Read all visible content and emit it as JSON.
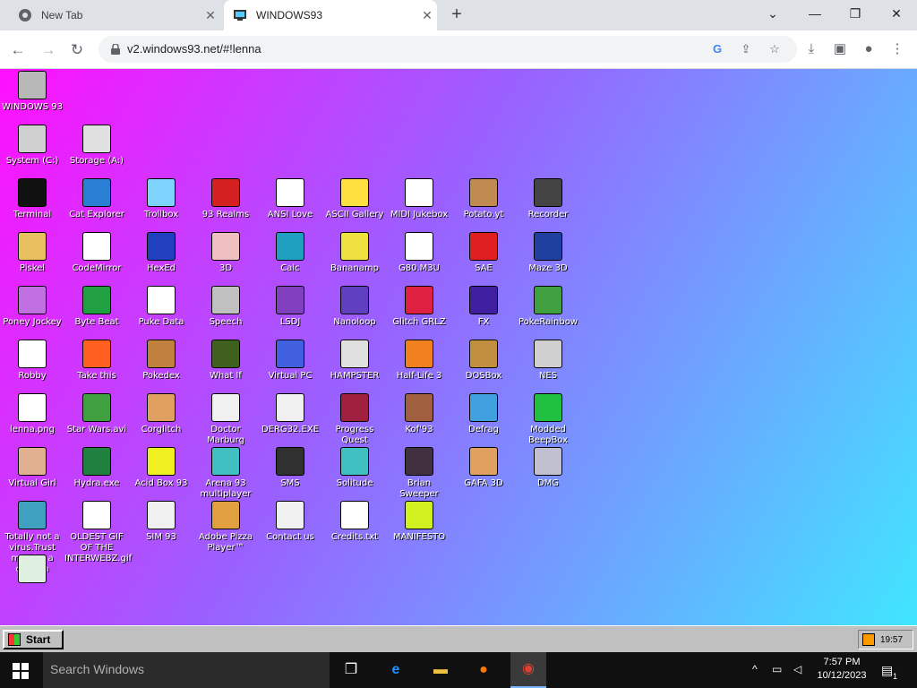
{
  "browser": {
    "tabs": [
      {
        "title": "New Tab"
      },
      {
        "title": "WINDOWS93"
      }
    ],
    "new_tab_symbol": "+",
    "url": "v2.windows93.net/#!lenna"
  },
  "desktop": {
    "icons": [
      {
        "label": "WINDOWS 93",
        "icon": "computer-icon",
        "color": "#b8b8b8"
      },
      {
        "label": "System (C:)",
        "icon": "drive-icon",
        "color": "#d0d0d0"
      },
      {
        "label": "Storage (A:)",
        "icon": "floppy-icon",
        "color": "#e0e0e0"
      },
      {
        "label": "Terminal",
        "icon": "terminal-icon",
        "color": "#111111"
      },
      {
        "label": "Cat Explorer",
        "icon": "globe-cat-icon",
        "color": "#2a7fd4"
      },
      {
        "label": "Trollbox",
        "icon": "chat-bubble-icon",
        "color": "#7fd4ff"
      },
      {
        "label": "93 Realms",
        "icon": "knight-icon",
        "color": "#d42020"
      },
      {
        "label": "ANSI Love",
        "icon": "letter-a-icon",
        "color": "#ffffff"
      },
      {
        "label": "ASCII Gallery",
        "icon": "numbers-icon",
        "color": "#ffe040"
      },
      {
        "label": "MIDI Jukebox",
        "icon": "piano-icon",
        "color": "#ffffff"
      },
      {
        "label": "Potato.yt",
        "icon": "potato-icon",
        "color": "#c08a50"
      },
      {
        "label": "Recorder",
        "icon": "microphone-icon",
        "color": "#444444"
      },
      {
        "label": "Piskel",
        "icon": "palette-icon",
        "color": "#e8c060"
      },
      {
        "label": "CodeMirror",
        "icon": "hand-icon",
        "color": "#ffffff"
      },
      {
        "label": "HexEd",
        "icon": "cube-icon",
        "color": "#2040c0"
      },
      {
        "label": "3D",
        "icon": "teapot-icon",
        "color": "#f0c0c0"
      },
      {
        "label": "Calc",
        "icon": "calculator-icon",
        "color": "#20a0c0"
      },
      {
        "label": "Bananamp",
        "icon": "banana-icon",
        "color": "#f0e040"
      },
      {
        "label": "G80.M3U",
        "icon": "music-file-icon",
        "color": "#ffffff"
      },
      {
        "label": "SAE",
        "icon": "amiga-ball-icon",
        "color": "#e02020"
      },
      {
        "label": "Maze 3D",
        "icon": "maze-icon",
        "color": "#2040a0"
      },
      {
        "label": "Poney Jockey",
        "icon": "pony-icon",
        "color": "#c070e0"
      },
      {
        "label": "Byte Beat",
        "icon": "byte-beat-icon",
        "color": "#20a040"
      },
      {
        "label": "Puke Data",
        "icon": "pd-icon",
        "color": "#ffffff"
      },
      {
        "label": "Speech",
        "icon": "face-icon",
        "color": "#c0c0c0"
      },
      {
        "label": "LSDJ",
        "icon": "gameboy-icon",
        "color": "#8040c0"
      },
      {
        "label": "Nanoloop",
        "icon": "wave-icon",
        "color": "#6040c0"
      },
      {
        "label": "Glitch GRLZ",
        "icon": "lips-icon",
        "color": "#e02040"
      },
      {
        "label": "FX",
        "icon": "atom-icon",
        "color": "#4020a0"
      },
      {
        "label": "PokeRainbow",
        "icon": "pokemon-icon",
        "color": "#40a040"
      },
      {
        "label": "Robby",
        "icon": "stick-figure-icon",
        "color": "#ffffff"
      },
      {
        "label": "Take this",
        "icon": "clown-icon",
        "color": "#ff6020"
      },
      {
        "label": "Pokedex",
        "icon": "pokedex-icon",
        "color": "#c08040"
      },
      {
        "label": "What If",
        "icon": "grid-icon",
        "color": "#406020"
      },
      {
        "label": "Virtual PC",
        "icon": "window-icon",
        "color": "#4060e0"
      },
      {
        "label": "HAMPSTER",
        "icon": "hamster-icon",
        "color": "#e0e0e0"
      },
      {
        "label": "Half-Life 3",
        "icon": "lambda-icon",
        "color": "#f08020"
      },
      {
        "label": "DOSBox",
        "icon": "dosbox-icon",
        "color": "#c09040"
      },
      {
        "label": "NES",
        "icon": "nes-icon",
        "color": "#d0d0d0"
      },
      {
        "label": "lenna.png",
        "icon": "image-file-icon",
        "color": "#ffffff"
      },
      {
        "label": "Star Wars.avi",
        "icon": "yoda-icon",
        "color": "#40a040"
      },
      {
        "label": "Corglitch",
        "icon": "corgi-icon",
        "color": "#e0a060"
      },
      {
        "label": "Doctor Marburg",
        "icon": "doctor-icon",
        "color": "#f0f0f0"
      },
      {
        "label": "DERG32.EXE",
        "icon": "monitor-face-icon",
        "color": "#f0f0f0"
      },
      {
        "label": "Progress Quest",
        "icon": "swords-icon",
        "color": "#a02040"
      },
      {
        "label": "Kof'93",
        "icon": "fighter-icon",
        "color": "#a06040"
      },
      {
        "label": "Defrag",
        "icon": "defrag-icon",
        "color": "#40a0e0"
      },
      {
        "label": "Modded BeepBox",
        "icon": "ring-icon",
        "color": "#20c040"
      },
      {
        "label": "Virtual Girl",
        "icon": "girl-portrait-icon",
        "color": "#e0b090"
      },
      {
        "label": "Hydra.exe",
        "icon": "dragon-icon",
        "color": "#208040"
      },
      {
        "label": "Acid Box 93",
        "icon": "smiley-icon",
        "color": "#f0f020"
      },
      {
        "label": "Arena 93 multiplayer",
        "icon": "3d-cube-icon",
        "color": "#40c0c0"
      },
      {
        "label": "SMS",
        "icon": "console-icon",
        "color": "#303030"
      },
      {
        "label": "Solitude",
        "icon": "jar-icon",
        "color": "#40c0c0"
      },
      {
        "label": "Brian Sweeper",
        "icon": "mine-icon",
        "color": "#403040"
      },
      {
        "label": "GAFA 3D",
        "icon": "doom-face-icon",
        "color": "#e0a060"
      },
      {
        "label": "DMG",
        "icon": "dmg-icon",
        "color": "#c0c0d0"
      },
      {
        "label": "Totally not a virus.Trust me...im a dolphin",
        "icon": "dolphin-icon",
        "color": "#40a0c0"
      },
      {
        "label": "OLDEST GIF OF THE INTERWEBZ.gif",
        "icon": "gif-file-icon",
        "color": "#ffffff"
      },
      {
        "label": "SIM 93",
        "icon": "book-icon",
        "color": "#f0f0f0"
      },
      {
        "label": "Adobe Pizza Player™",
        "icon": "pizza-icon",
        "color": "#e0a040"
      },
      {
        "label": "Contact us",
        "icon": "contact-icon",
        "color": "#f0f0f0"
      },
      {
        "label": "Credits.txt",
        "icon": "text-file-icon",
        "color": "#ffffff"
      },
      {
        "label": "MANIFESTO",
        "icon": "question-mark-icon",
        "color": "#d0f020"
      },
      {
        "label": "",
        "icon": "recycle-bin-icon",
        "color": "#e0f0e0"
      }
    ]
  },
  "w93_taskbar": {
    "start_label": "Start",
    "clock": "19:57"
  },
  "os_taskbar": {
    "search_placeholder": "Search Windows",
    "time": "7:57 PM",
    "date": "10/12/2023",
    "notification_count": "1"
  }
}
